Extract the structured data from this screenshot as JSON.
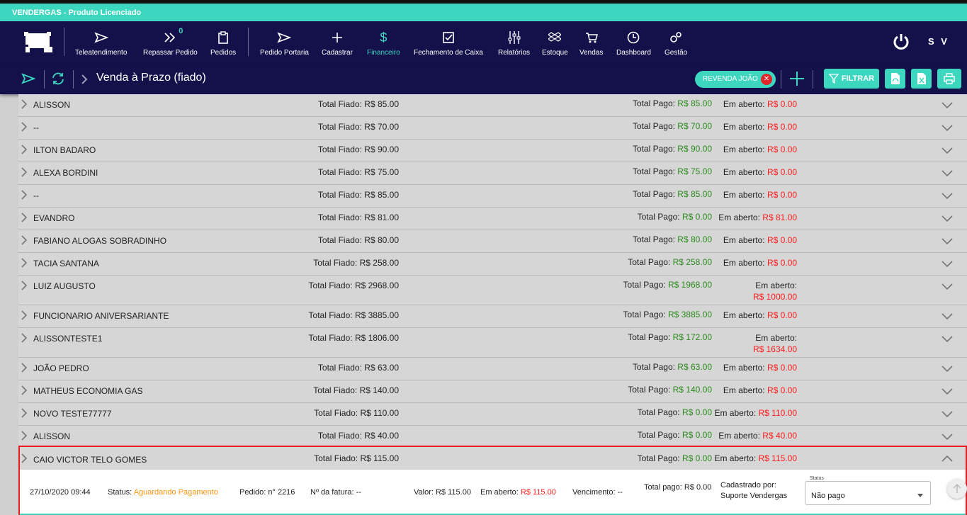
{
  "license_text": "VENDERGAS - Produto Licenciado",
  "nav": {
    "items": [
      {
        "label": "Teleatendimento",
        "icon": "send-icon"
      },
      {
        "label": "Repassar Pedido",
        "icon": "double-chevron-icon",
        "badge": "0"
      },
      {
        "label": "Pedidos",
        "icon": "clipboard-icon"
      },
      {
        "label": "Pedido Portaria",
        "icon": "send-icon"
      },
      {
        "label": "Cadastrar",
        "icon": "plus-icon"
      },
      {
        "label": "Financeiro",
        "icon": "dollar-icon",
        "active": true
      },
      {
        "label": "Fechamento de Caixa",
        "icon": "checkbox-icon"
      },
      {
        "label": "Relatórios",
        "icon": "sliders-icon"
      },
      {
        "label": "Estoque",
        "icon": "dropbox-icon"
      },
      {
        "label": "Vendas",
        "icon": "cart-icon"
      },
      {
        "label": "Dashboard",
        "icon": "clock-icon"
      },
      {
        "label": "Gestão",
        "icon": "gears-icon"
      }
    ],
    "user_initials": "S V"
  },
  "subbar": {
    "title": "Venda à Prazo (fiado)",
    "chip": "REVENDA JOÃO",
    "filter_label": "FILTRAR"
  },
  "labels": {
    "fiado": "Total Fiado:",
    "pago": "Total Pago:",
    "aberto": "Em aberto:"
  },
  "rows": [
    {
      "name": "ALISSON",
      "fiado": "R$ 85.00",
      "pago": "R$ 85.00",
      "aberto": "R$ 0.00"
    },
    {
      "name": "--",
      "fiado": "R$ 70.00",
      "pago": "R$ 70.00",
      "aberto": "R$ 0.00"
    },
    {
      "name": "ILTON BADARO",
      "fiado": "R$ 90.00",
      "pago": "R$ 90.00",
      "aberto": "R$ 0.00"
    },
    {
      "name": "ALEXA BORDINI",
      "fiado": "R$ 75.00",
      "pago": "R$ 75.00",
      "aberto": "R$ 0.00"
    },
    {
      "name": "--",
      "fiado": "R$ 85.00",
      "pago": "R$ 85.00",
      "aberto": "R$ 0.00"
    },
    {
      "name": "EVANDRO",
      "fiado": "R$ 81.00",
      "pago": "R$ 0.00",
      "aberto": "R$ 81.00"
    },
    {
      "name": "FABIANO ALOGAS SOBRADINHO",
      "fiado": "R$ 80.00",
      "pago": "R$ 80.00",
      "aberto": "R$ 0.00"
    },
    {
      "name": "TACIA SANTANA",
      "fiado": "R$ 258.00",
      "pago": "R$ 258.00",
      "aberto": "R$ 0.00"
    },
    {
      "name": "LUIZ AUGUSTO",
      "fiado": "R$ 2968.00",
      "pago": "R$ 1968.00",
      "aberto": "R$ 1000.00",
      "wrap": true
    },
    {
      "name": "FUNCIONARIO ANIVERSARIANTE",
      "fiado": "R$ 3885.00",
      "pago": "R$ 3885.00",
      "aberto": "R$ 0.00"
    },
    {
      "name": "ALISSONTESTE1",
      "fiado": "R$ 1806.00",
      "pago": "R$ 172.00",
      "aberto": "R$ 1634.00",
      "wrap": true
    },
    {
      "name": "JOÃO PEDRO",
      "fiado": "R$ 63.00",
      "pago": "R$ 63.00",
      "aberto": "R$ 0.00"
    },
    {
      "name": "MATHEUS ECONOMIA GAS",
      "fiado": "R$ 140.00",
      "pago": "R$ 140.00",
      "aberto": "R$ 0.00"
    },
    {
      "name": "NOVO TESTE77777",
      "fiado": "R$ 110.00",
      "pago": "R$ 0.00",
      "aberto": "R$ 110.00"
    },
    {
      "name": "ALISSON",
      "fiado": "R$ 40.00",
      "pago": "R$ 0.00",
      "aberto": "R$ 40.00"
    }
  ],
  "expanded": {
    "name": "CAIO VICTOR TELO GOMES",
    "fiado": "R$ 115.00",
    "pago": "R$ 0.00",
    "aberto": "R$ 115.00",
    "detail": {
      "datetime": "27/10/2020 09:44",
      "status_label": "Status:",
      "status_value": "Aguardando Pagamento",
      "pedido_label": "Pedido:",
      "pedido_value": "n° 2216",
      "fatura_label": "Nº da fatura:",
      "fatura_value": "--",
      "valor_label": "Valor:",
      "valor_value": "R$ 115.00",
      "aberto_label": "Em aberto:",
      "aberto_value": "R$ 115.00",
      "venc_label": "Vencimento:",
      "venc_value": "--",
      "total_pago_label": "Total pago:",
      "total_pago_value": "R$ 0.00",
      "cadastrado_label": "Cadastrado por:",
      "cadastrado_value": "Suporte Vendergas",
      "status_field_label": "Status",
      "status_field_value": "Não pago"
    }
  },
  "colors": {
    "teal": "#3dd6bf",
    "navy": "#14104a",
    "green": "#2a8a1c",
    "red": "#ff1a1a",
    "orange": "#ff9512"
  }
}
